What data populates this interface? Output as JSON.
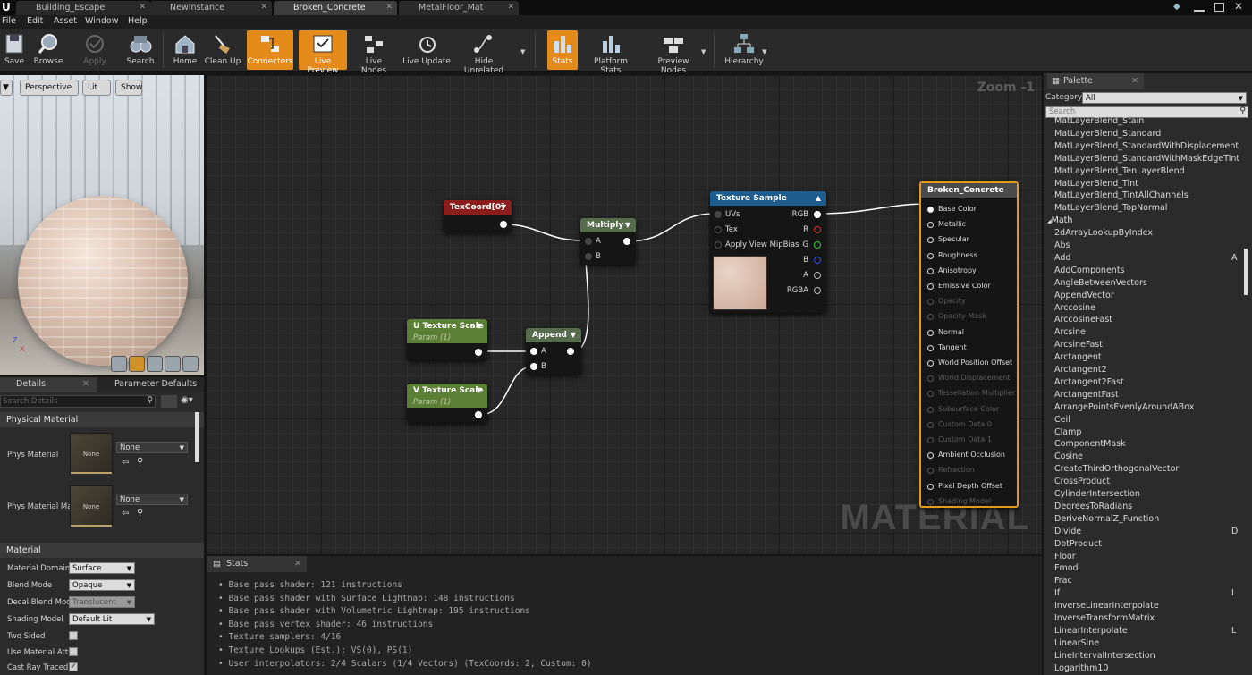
{
  "tabs": [
    {
      "label": "Building_Escape"
    },
    {
      "label": "NewInstance"
    },
    {
      "label": "Broken_Concrete"
    },
    {
      "label": "MetalFloor_Mat"
    }
  ],
  "menu": [
    "File",
    "Edit",
    "Asset",
    "Window",
    "Help"
  ],
  "toolbar": {
    "save": "Save",
    "browse": "Browse",
    "apply": "Apply",
    "search": "Search",
    "home": "Home",
    "clean_up": "Clean Up",
    "connectors": "Connectors",
    "live_preview": "Live Preview",
    "live_nodes": "Live Nodes",
    "live_update": "Live Update",
    "hide_unrelated": "Hide Unrelated",
    "stats": "Stats",
    "platform_stats": "Platform Stats",
    "preview_nodes": "Preview Nodes",
    "hierarchy": "Hierarchy"
  },
  "viewport": {
    "perspective": "Perspective",
    "lit": "Lit",
    "show": "Show",
    "axis_z": "Z",
    "axis_x": "X"
  },
  "details": {
    "tab_details": "Details",
    "tab_params": "Parameter Defaults",
    "search_placeholder": "Search Details",
    "section_physical": "Physical Material",
    "phys_material": "Phys Material",
    "phys_material_mask": "Phys Material Ma",
    "none": "None",
    "section_material": "Material",
    "material_domain": "Material Domain",
    "material_domain_value": "Surface",
    "blend_mode": "Blend Mode",
    "blend_mode_value": "Opaque",
    "decal_blend": "Decal Blend Mode",
    "decal_blend_value": "Translucent",
    "shading_model": "Shading Model",
    "shading_model_value": "Default Lit",
    "two_sided": "Two Sided",
    "use_material_attr": "Use Material Attri",
    "cast_ray": "Cast Ray Traced"
  },
  "graph": {
    "zoom": "Zoom -1",
    "watermark": "MATERIAL",
    "texcoord": {
      "title": "TexCoord[0]"
    },
    "multiply": {
      "title": "Multiply",
      "a": "A",
      "b": "B"
    },
    "append": {
      "title": "Append",
      "a": "A",
      "b": "B"
    },
    "u_scale": {
      "title": "U Texture Scale",
      "sub": "Param (1)"
    },
    "v_scale": {
      "title": "V Texture Scale",
      "sub": "Param (1)"
    },
    "texture_sample": {
      "title": "Texture Sample",
      "uvs": "UVs",
      "tex": "Tex",
      "mip": "Apply View MipBias",
      "rgb": "RGB",
      "r": "R",
      "g": "G",
      "b": "B",
      "a": "A",
      "rgba": "RGBA"
    },
    "result": {
      "title": "Broken_Concrete",
      "inputs": [
        {
          "label": "Base Color",
          "enabled": true
        },
        {
          "label": "Metallic",
          "enabled": true
        },
        {
          "label": "Specular",
          "enabled": true
        },
        {
          "label": "Roughness",
          "enabled": true
        },
        {
          "label": "Anisotropy",
          "enabled": true
        },
        {
          "label": "Emissive Color",
          "enabled": true
        },
        {
          "label": "Opacity",
          "enabled": false
        },
        {
          "label": "Opacity Mask",
          "enabled": false
        },
        {
          "label": "Normal",
          "enabled": true
        },
        {
          "label": "Tangent",
          "enabled": true
        },
        {
          "label": "World Position Offset",
          "enabled": true
        },
        {
          "label": "World Displacement",
          "enabled": false
        },
        {
          "label": "Tessellation Multiplier",
          "enabled": false
        },
        {
          "label": "Subsurface Color",
          "enabled": false
        },
        {
          "label": "Custom Data 0",
          "enabled": false
        },
        {
          "label": "Custom Data 1",
          "enabled": false
        },
        {
          "label": "Ambient Occlusion",
          "enabled": true
        },
        {
          "label": "Refraction",
          "enabled": false
        },
        {
          "label": "Pixel Depth Offset",
          "enabled": true
        },
        {
          "label": "Shading Model",
          "enabled": false
        }
      ]
    }
  },
  "stats": {
    "tab": "Stats",
    "lines": [
      "Base pass shader: 121 instructions",
      "Base pass shader with Surface Lightmap: 148 instructions",
      "Base pass shader with Volumetric Lightmap: 195 instructions",
      "Base pass vertex shader: 46 instructions",
      "Texture samplers: 4/16",
      "Texture Lookups (Est.): VS(0), PS(1)",
      "User interpolators: 2/4 Scalars (1/4 Vectors) (TexCoords: 2, Custom: 0)"
    ]
  },
  "palette": {
    "tab": "Palette",
    "category_label": "Category:",
    "category_value": "All",
    "search_placeholder": "Search",
    "items": [
      "MatLayerBlend_Stain",
      "MatLayerBlend_Standard",
      "MatLayerBlend_StandardWithDisplacement",
      "MatLayerBlend_StandardWithMaskEdgeTint",
      "MatLayerBlend_TenLayerBlend",
      "MatLayerBlend_Tint",
      "MatLayerBlend_TintAllChannels",
      "MatLayerBlend_TopNormal"
    ],
    "category_math": "Math",
    "math_items": [
      "2dArrayLookupByIndex",
      "Abs",
      "Add",
      "AddComponents",
      "AngleBetweenVectors",
      "AppendVector",
      "Arccosine",
      "ArccosineFast",
      "Arcsine",
      "ArcsineFast",
      "Arctangent",
      "Arctangent2",
      "Arctangent2Fast",
      "ArctangentFast",
      "ArrangePointsEvenlyAroundABox",
      "Ceil",
      "Clamp",
      "ComponentMask",
      "Cosine",
      "CreateThirdOrthogonalVector",
      "CrossProduct",
      "CylinderIntersection",
      "DegreesToRadians",
      "DeriveNormalZ_Function",
      "Divide",
      "DotProduct",
      "Floor",
      "Fmod",
      "Frac",
      "If",
      "InverseLinearInterpolate",
      "InverseTransformMatrix",
      "LinearInterpolate",
      "LinearSine",
      "LineIntervalIntersection",
      "Logarithm10"
    ],
    "hotkeys": {
      "add": "A",
      "divide": "D",
      "if": "I",
      "lerp": "L"
    }
  },
  "colors": {
    "accent": "#e58b1b",
    "tex_header": "#1d5c8c",
    "param_header": "#5b7f34",
    "texcoord_header": "#8c1d1d",
    "math_header": "#576b4d"
  }
}
